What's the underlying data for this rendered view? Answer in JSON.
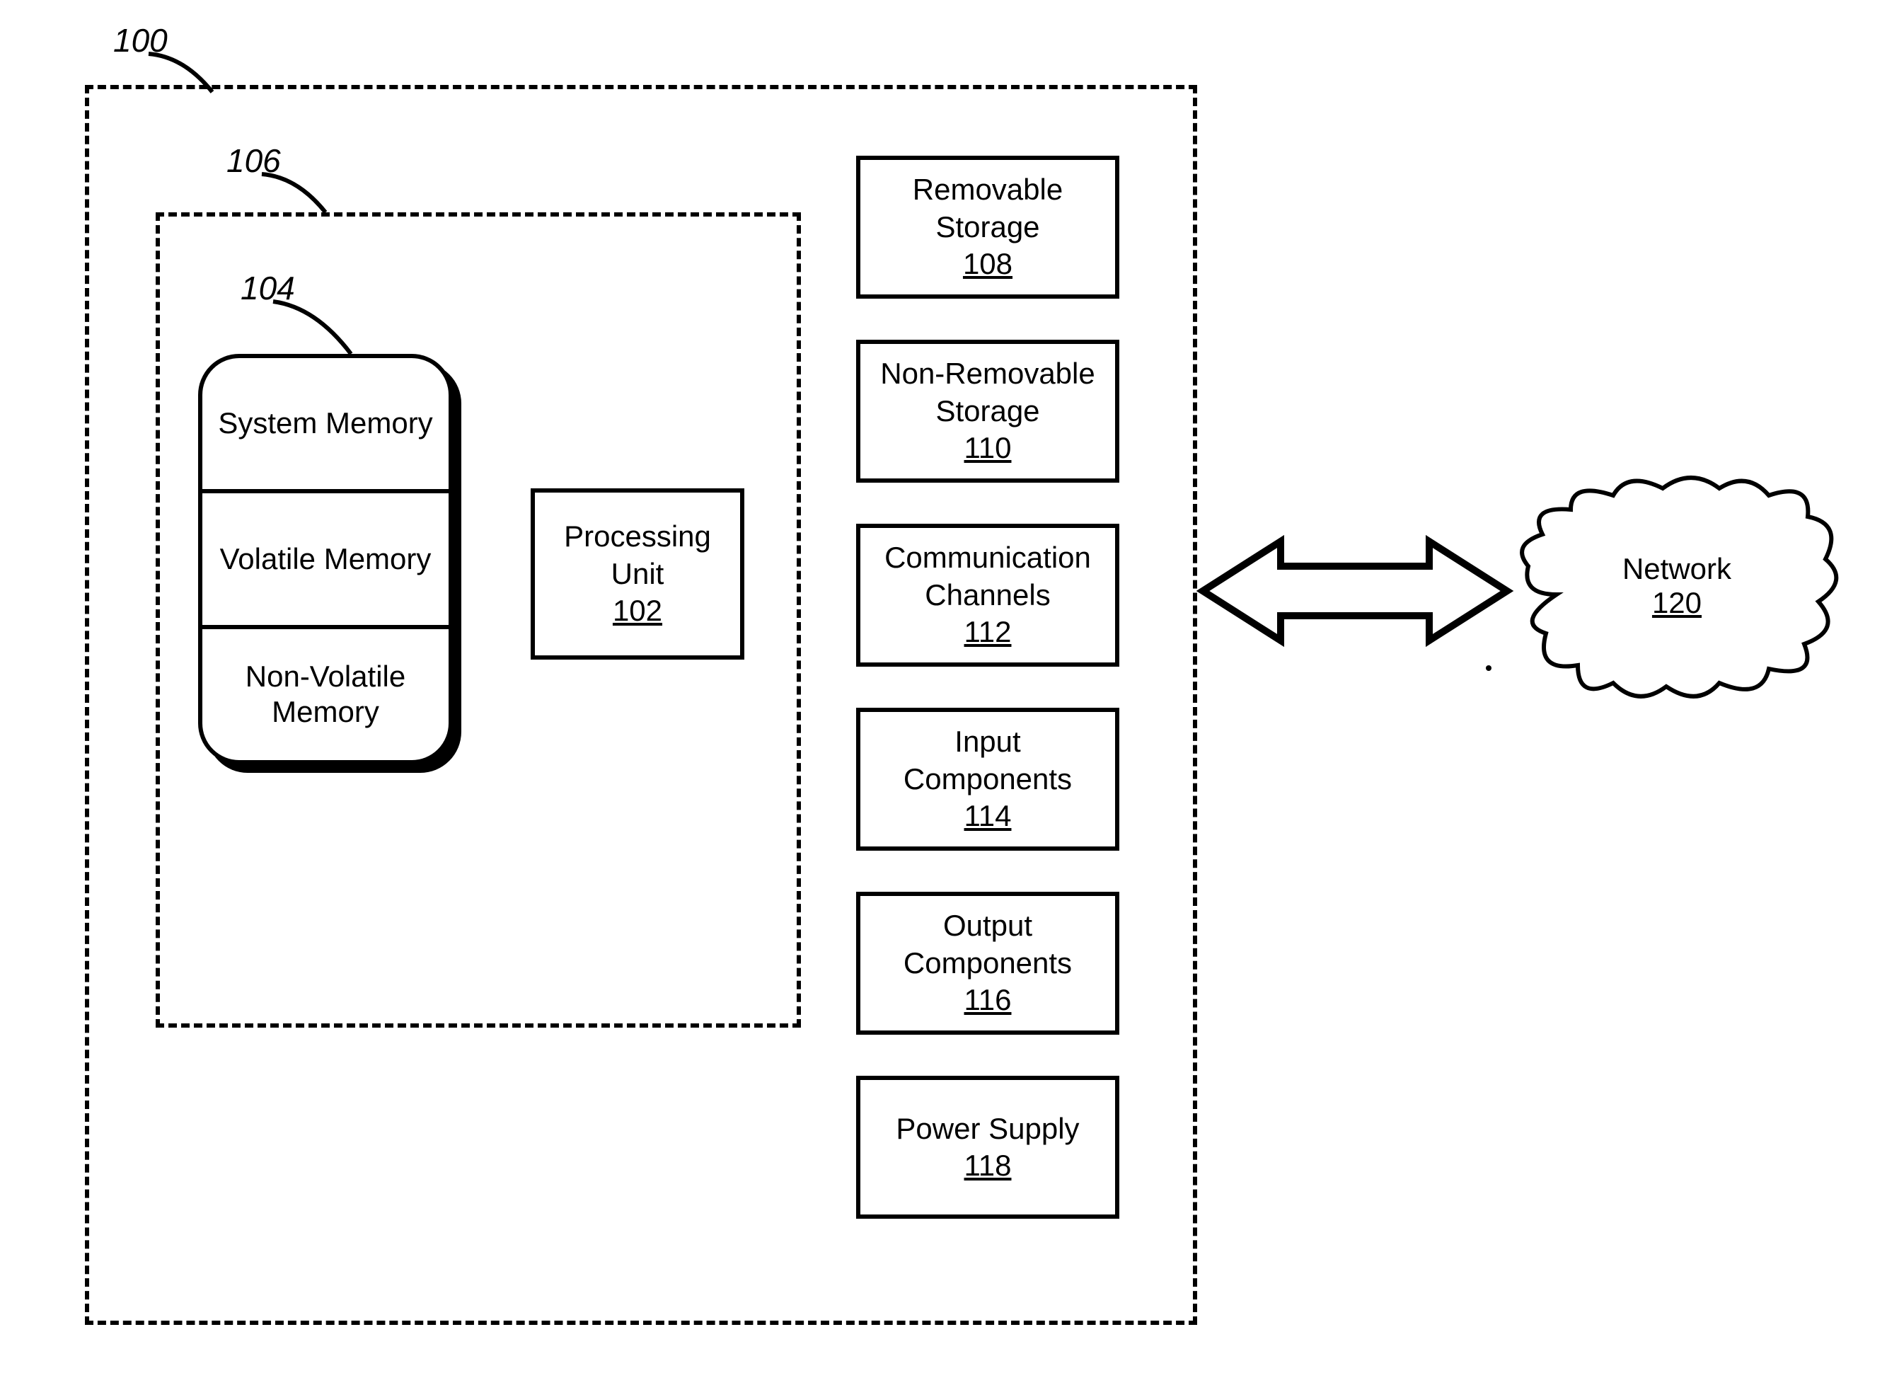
{
  "annotations": {
    "outer": "100",
    "inner": "106",
    "memory": "104"
  },
  "memory": {
    "system_memory": "System Memory",
    "volatile_memory": "Volatile Memory",
    "non_volatile_memory": "Non-Volatile Memory"
  },
  "processing_unit": {
    "label": "Processing Unit",
    "id": "102"
  },
  "blocks": {
    "removable_storage": {
      "label1": "Removable",
      "label2": "Storage",
      "id": "108"
    },
    "non_removable_storage": {
      "label1": "Non-Removable",
      "label2": "Storage",
      "id": "110"
    },
    "communication": {
      "label1": "Communication",
      "label2": "Channels",
      "id": "112"
    },
    "input_components": {
      "label1": "Input",
      "label2": "Components",
      "id": "114"
    },
    "output_components": {
      "label1": "Output",
      "label2": "Components",
      "id": "116"
    },
    "power_supply": {
      "label1": "Power Supply",
      "id": "118"
    }
  },
  "network": {
    "label": "Network",
    "id": "120"
  }
}
